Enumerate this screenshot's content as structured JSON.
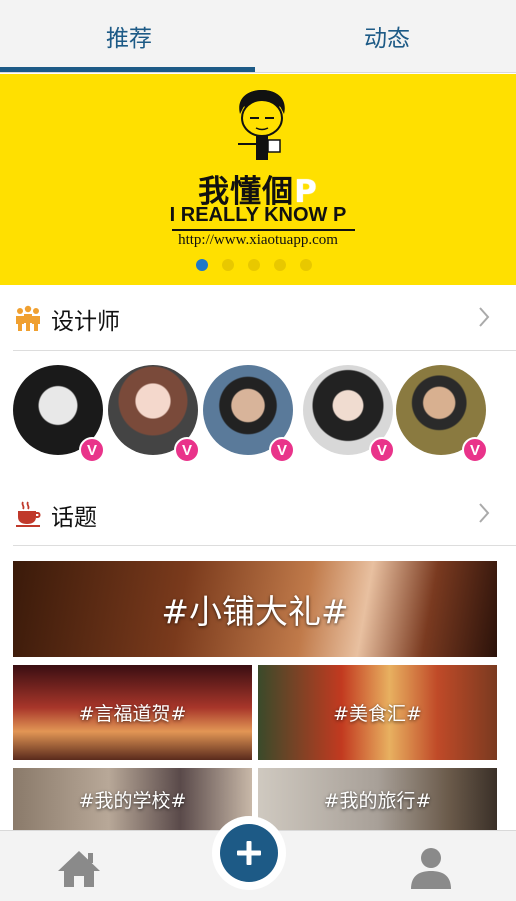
{
  "tabs": [
    {
      "label": "推荐",
      "active": true
    },
    {
      "label": "动态",
      "active": false
    }
  ],
  "banner": {
    "brand_cn": "我懂個",
    "brand_cn_accent": "P",
    "brand_en": "I REALLY KNOW P",
    "url": "http://www.xiaotuapp.com",
    "slides_total": 5,
    "slide_active_index": 0,
    "background_color": "#ffe000"
  },
  "designers": {
    "title": "设计师",
    "icon": "people-icon",
    "avatars": [
      {
        "badge": "V"
      },
      {
        "badge": "V"
      },
      {
        "badge": "V"
      },
      {
        "badge": "V"
      },
      {
        "badge": "V"
      }
    ]
  },
  "topics": {
    "title": "话题",
    "icon": "coffee-cup-icon",
    "items": [
      {
        "label": "#小铺大礼#"
      },
      {
        "label": "#言福道贺#"
      },
      {
        "label": "#美食汇#"
      },
      {
        "label": "#我的学校#"
      },
      {
        "label": "#我的旅行#"
      }
    ]
  },
  "bottom_nav": {
    "home_icon": "home-icon",
    "add_icon": "plus-icon",
    "profile_icon": "user-icon"
  },
  "colors": {
    "accent": "#1d5a86",
    "badge": "#e9338a",
    "section_icon": "#f0a030"
  }
}
